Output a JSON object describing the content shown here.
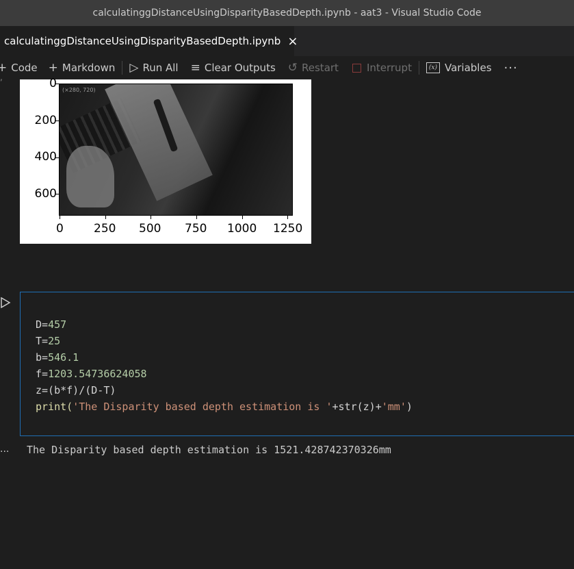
{
  "window": {
    "title": "calculatinggDistanceUsingDisparityBasedDepth.ipynb - aat3 - Visual Studio Code"
  },
  "tab": {
    "label": "calculatinggDistanceUsingDisparityBasedDepth.ipynb",
    "close": "×"
  },
  "toolbar": {
    "code": "Code",
    "markdown": "Markdown",
    "run_all": "Run All",
    "clear_outputs": "Clear Outputs",
    "restart": "Restart",
    "interrupt": "Interrupt",
    "variables": "Variables",
    "more": "···"
  },
  "plot": {
    "image_coord_text": "(×280, 720)",
    "y_ticks": [
      "0",
      "200",
      "400",
      "600"
    ],
    "x_ticks": [
      "0",
      "250",
      "500",
      "750",
      "1000",
      "1250"
    ]
  },
  "cell": {
    "lines": [
      {
        "pre": "D=",
        "num": "457"
      },
      {
        "pre": "T=",
        "num": "25"
      },
      {
        "pre": "b=",
        "num": "546.1"
      },
      {
        "pre": "f=",
        "num": "1203.54736624058"
      },
      {
        "pre": "z=(b*f)/(D-T)",
        "num": ""
      }
    ],
    "print_fn": "print(",
    "print_str1": "'The Disparity based depth estimation is '",
    "print_mid": "+str(z)+",
    "print_str2": "'mm'",
    "print_end": ")"
  },
  "output": {
    "dots": "···",
    "text": "The Disparity based depth estimation is 1521.428742370326mm"
  }
}
